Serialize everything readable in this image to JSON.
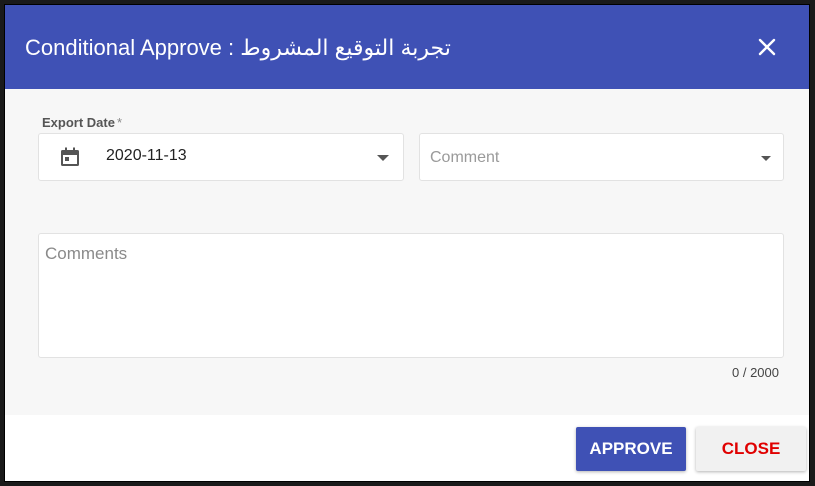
{
  "dialog": {
    "title": "Conditional Approve : تجربة التوقيع المشروط",
    "close_icon": "close-icon"
  },
  "form": {
    "export_date": {
      "label": "Export Date",
      "required_mark": "*",
      "value": "2020-11-13",
      "icon": "calendar-icon"
    },
    "comment_select": {
      "placeholder": "Comment"
    },
    "comments": {
      "placeholder": "Comments",
      "value": "",
      "counter": "0 / 2000"
    }
  },
  "actions": {
    "approve_label": "APPROVE",
    "close_label": "CLOSE"
  },
  "colors": {
    "header": "#3f51b5",
    "approve_bg": "#3f51b5",
    "close_text": "#e00000"
  }
}
